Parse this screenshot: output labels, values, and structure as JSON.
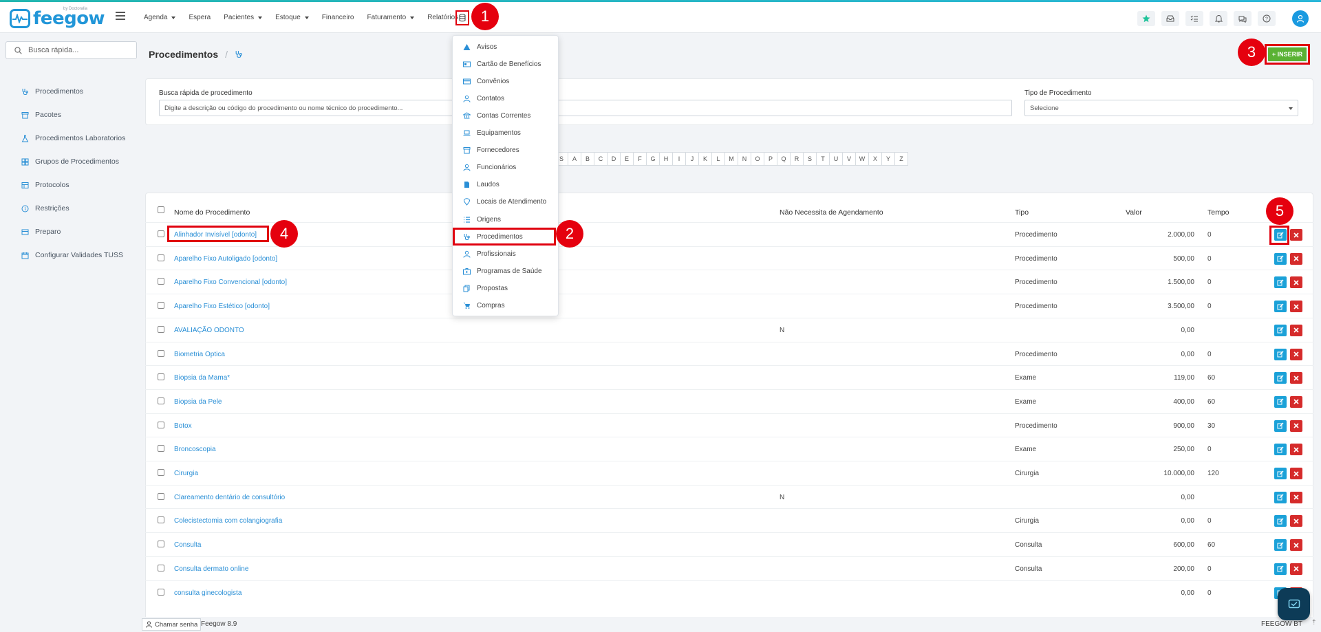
{
  "app": {
    "logo_text": "feegow",
    "logo_by": "by Doctoralia"
  },
  "colors": {
    "brand": "#2196d8",
    "insert_green": "#5ab234",
    "edit_blue": "#1ba1d8",
    "delete_red": "#d52b2b",
    "callout_red": "#e5000e"
  },
  "topnav": [
    {
      "label": "Agenda",
      "dropdown": true
    },
    {
      "label": "Espera",
      "dropdown": false
    },
    {
      "label": "Pacientes",
      "dropdown": true
    },
    {
      "label": "Estoque",
      "dropdown": true
    },
    {
      "label": "Financeiro",
      "dropdown": false
    },
    {
      "label": "Faturamento",
      "dropdown": true
    },
    {
      "label": "Relatórios",
      "dropdown": false
    }
  ],
  "sidebar": {
    "search_placeholder": "Busca rápida...",
    "items": [
      "Procedimentos",
      "Pacotes",
      "Procedimentos Laboratorios",
      "Grupos de Procedimentos",
      "Protocolos",
      "Restrições",
      "Preparo",
      "Configurar Validades TUSS"
    ]
  },
  "page": {
    "title": "Procedimentos",
    "insert_label": "+ INSERIR"
  },
  "filters": {
    "search_label": "Busca rápida de procedimento",
    "search_placeholder": "Digite a descrição ou código do procedimento ou nome técnico do procedimento...",
    "type_label": "Tipo de Procedimento",
    "type_value": "Selecione"
  },
  "alphabet": [
    "S",
    "A",
    "B",
    "C",
    "D",
    "E",
    "F",
    "G",
    "H",
    "I",
    "J",
    "K",
    "L",
    "M",
    "N",
    "O",
    "P",
    "Q",
    "R",
    "S",
    "T",
    "U",
    "V",
    "W",
    "X",
    "Y",
    "Z"
  ],
  "table": {
    "headers": {
      "name": "Nome do Procedimento",
      "nao": "Não Necessita de Agendamento",
      "tipo": "Tipo",
      "valor": "Valor",
      "tempo": "Tempo"
    },
    "rows": [
      {
        "name": "Alinhador Invisível [odonto]",
        "nao": "",
        "tipo": "Procedimento",
        "valor": "2.000,00",
        "tempo": "0"
      },
      {
        "name": "Aparelho Fixo Autoligado [odonto]",
        "nao": "",
        "tipo": "Procedimento",
        "valor": "500,00",
        "tempo": "0"
      },
      {
        "name": "Aparelho Fixo Convencional [odonto]",
        "nao": "",
        "tipo": "Procedimento",
        "valor": "1.500,00",
        "tempo": "0"
      },
      {
        "name": "Aparelho Fixo Estético [odonto]",
        "nao": "",
        "tipo": "Procedimento",
        "valor": "3.500,00",
        "tempo": "0"
      },
      {
        "name": "AVALIAÇÃO ODONTO",
        "nao": "N",
        "tipo": "",
        "valor": "0,00",
        "tempo": ""
      },
      {
        "name": "Biometria Optica",
        "nao": "",
        "tipo": "Procedimento",
        "valor": "0,00",
        "tempo": "0"
      },
      {
        "name": "Biopsia da Mama*",
        "nao": "",
        "tipo": "Exame",
        "valor": "119,00",
        "tempo": "60"
      },
      {
        "name": "Biopsia da Pele",
        "nao": "",
        "tipo": "Exame",
        "valor": "400,00",
        "tempo": "60"
      },
      {
        "name": "Botox",
        "nao": "",
        "tipo": "Procedimento",
        "valor": "900,00",
        "tempo": "30"
      },
      {
        "name": "Broncoscopia",
        "nao": "",
        "tipo": "Exame",
        "valor": "250,00",
        "tempo": "0"
      },
      {
        "name": "Cirurgia",
        "nao": "",
        "tipo": "Cirurgia",
        "valor": "10.000,00",
        "tempo": "120"
      },
      {
        "name": "Clareamento dentário de consultório",
        "nao": "N",
        "tipo": "",
        "valor": "0,00",
        "tempo": ""
      },
      {
        "name": "Colecistectomia com colangiografia",
        "nao": "",
        "tipo": "Cirurgia",
        "valor": "0,00",
        "tempo": "0"
      },
      {
        "name": "Consulta",
        "nao": "",
        "tipo": "Consulta",
        "valor": "600,00",
        "tempo": "60"
      },
      {
        "name": "Consulta dermato online",
        "nao": "",
        "tipo": "Consulta",
        "valor": "200,00",
        "tempo": "0"
      },
      {
        "name": "consulta ginecologista",
        "nao": "",
        "tipo": "",
        "valor": "0,00",
        "tempo": "0"
      }
    ]
  },
  "cadastros_menu": [
    {
      "label": "Avisos",
      "icon": "warning-icon"
    },
    {
      "label": "Cartão de Benefícios",
      "icon": "id-card-icon"
    },
    {
      "label": "Convênios",
      "icon": "credit-card-icon"
    },
    {
      "label": "Contatos",
      "icon": "user-icon"
    },
    {
      "label": "Contas Correntes",
      "icon": "bank-icon"
    },
    {
      "label": "Equipamentos",
      "icon": "laptop-icon"
    },
    {
      "label": "Fornecedores",
      "icon": "archive-icon"
    },
    {
      "label": "Funcionários",
      "icon": "user-icon"
    },
    {
      "label": "Laudos",
      "icon": "file-icon"
    },
    {
      "label": "Locais de Atendimento",
      "icon": "location-icon"
    },
    {
      "label": "Origens",
      "icon": "list-icon"
    },
    {
      "label": "Procedimentos",
      "icon": "stethoscope-icon"
    },
    {
      "label": "Profissionais",
      "icon": "user-icon"
    },
    {
      "label": "Programas de Saúde",
      "icon": "medkit-icon"
    },
    {
      "label": "Propostas",
      "icon": "copy-icon"
    },
    {
      "label": "Compras",
      "icon": "cart-icon"
    }
  ],
  "callouts": [
    "1",
    "2",
    "3",
    "4",
    "5"
  ],
  "footer": {
    "chamar": "Chamar senha",
    "version": "Feegow 8.9",
    "right": "FEEGOW BT"
  }
}
